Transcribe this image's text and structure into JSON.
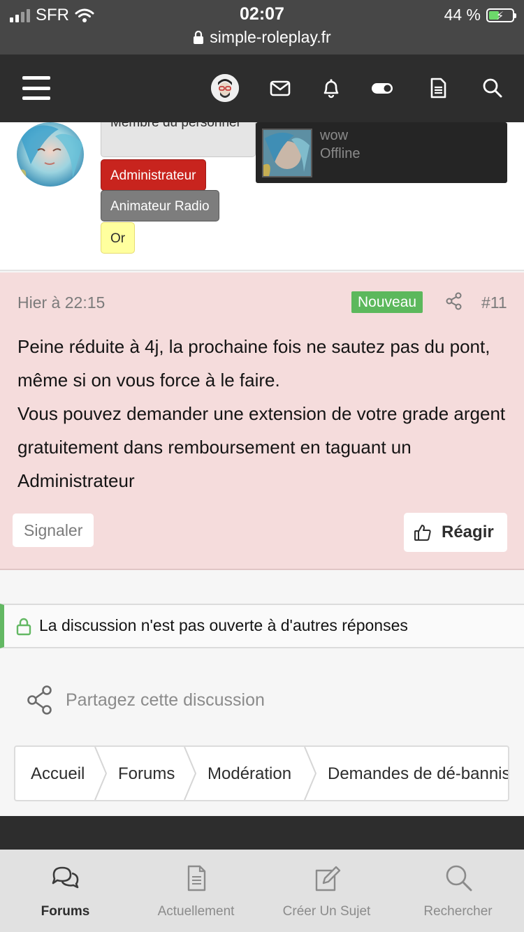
{
  "status_bar": {
    "carrier": "SFR",
    "time": "02:07",
    "battery": "44 %",
    "battery_level": 0.44,
    "url": "simple-roleplay.fr"
  },
  "navbar": {
    "icons": [
      "menu-icon",
      "avatar",
      "mail-icon",
      "bell-icon",
      "toggle-icon",
      "document-icon",
      "search-icon"
    ]
  },
  "profile": {
    "badges": {
      "staff": "Membre du personnel",
      "admin": "Administrateur",
      "animator": "Animateur Radio",
      "gold": "Or"
    },
    "tooltip": {
      "name": "wow",
      "status": "Offline"
    }
  },
  "post": {
    "date": "Hier à 22:15",
    "tag": "Nouveau",
    "number": "#11",
    "line1": "Peine réduite à 4j, la prochaine fois ne sautez pas du pont, même si on vous force à le faire.",
    "line2": "Vous pouvez demander une extension de votre grade argent gratuitement dans remboursement en taguant un Administrateur",
    "report_label": "Signaler",
    "react_label": "Réagir"
  },
  "notice": {
    "text": "La discussion n'est pas ouverte à d'autres réponses"
  },
  "share": {
    "label": "Partagez cette discussion"
  },
  "breadcrumb": [
    "Accueil",
    "Forums",
    "Modération",
    "Demandes de dé-bannissement"
  ],
  "tabbar": {
    "items": [
      {
        "label": "Forums",
        "icon": "chat-bubbles-icon",
        "active": true
      },
      {
        "label": "Actuellement",
        "icon": "document-icon",
        "active": false
      },
      {
        "label": "Créer Un Sujet",
        "icon": "edit-icon",
        "active": false
      },
      {
        "label": "Rechercher",
        "icon": "search-icon",
        "active": false
      }
    ]
  },
  "colors": {
    "nav_bg": "#2d2d2d",
    "post_bg": "#f5dcdc",
    "admin_badge": "#c8241e",
    "new_tag": "#5cb85c",
    "notice_accent": "#63b863"
  }
}
